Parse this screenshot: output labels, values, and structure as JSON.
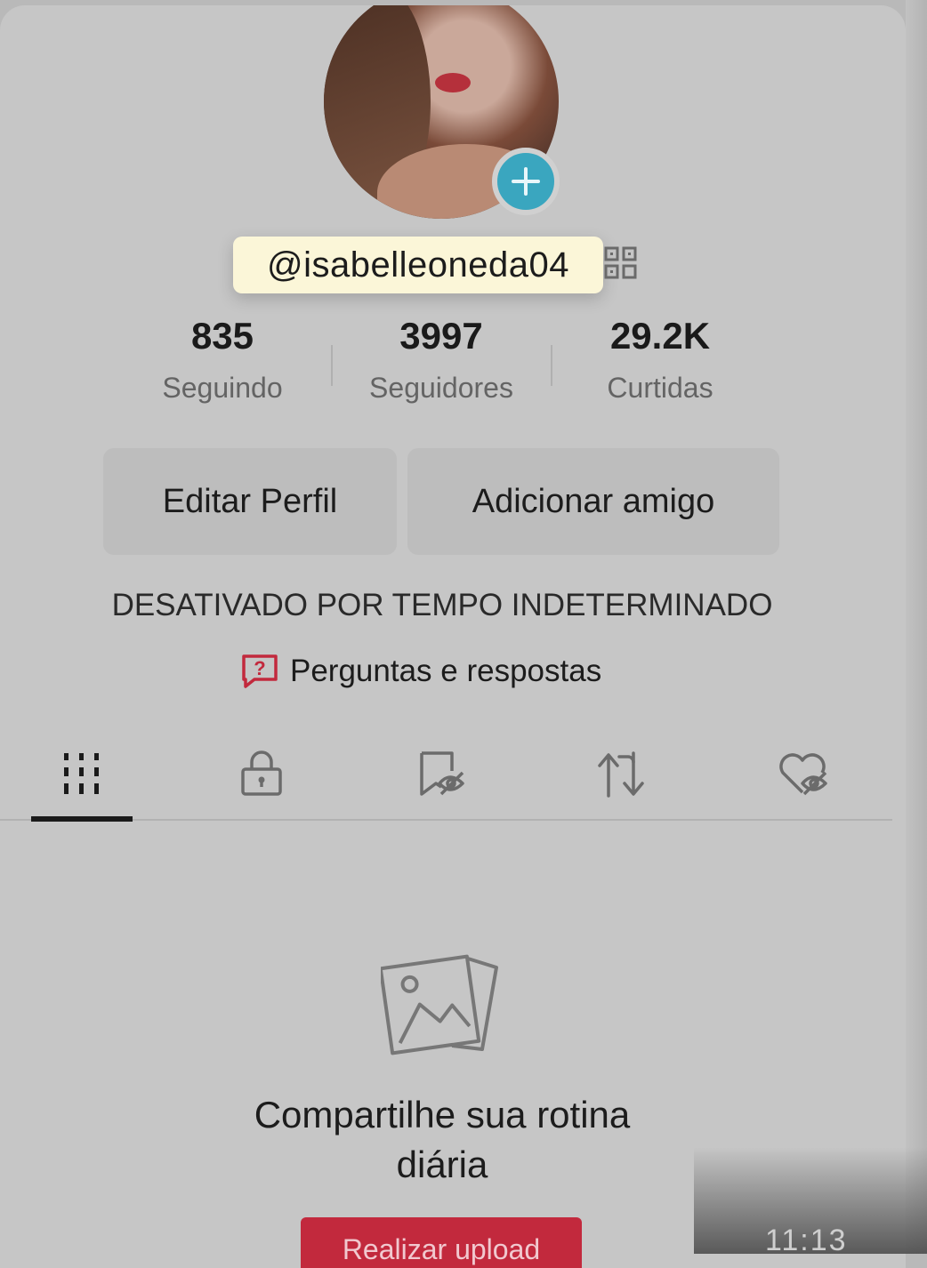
{
  "profile": {
    "username": "@isabelleoneda04",
    "bio": "DESATIVADO POR TEMPO INDETERMINADO",
    "qa_link": "Perguntas e respostas"
  },
  "stats": [
    {
      "value": "835",
      "label": "Seguindo"
    },
    {
      "value": "3997",
      "label": "Seguidores"
    },
    {
      "value": "29.2K",
      "label": "Curtidas"
    }
  ],
  "buttons": {
    "edit_profile": "Editar Perfil",
    "add_friend": "Adicionar amigo"
  },
  "tabs": [
    {
      "icon": "grid-icon",
      "active": true
    },
    {
      "icon": "lock-icon",
      "active": false
    },
    {
      "icon": "hidden-saved-icon",
      "active": false
    },
    {
      "icon": "repost-icon",
      "active": false
    },
    {
      "icon": "hidden-liked-icon",
      "active": false
    }
  ],
  "empty_state": {
    "title_line1": "Compartilhe sua rotina",
    "title_line2": "diária",
    "upload_button": "Realizar upload"
  },
  "status_time": "11:13",
  "colors": {
    "accent_red": "#c2293d",
    "avatar_add": "#3aa6bf",
    "highlight": "#fbf6d8"
  }
}
